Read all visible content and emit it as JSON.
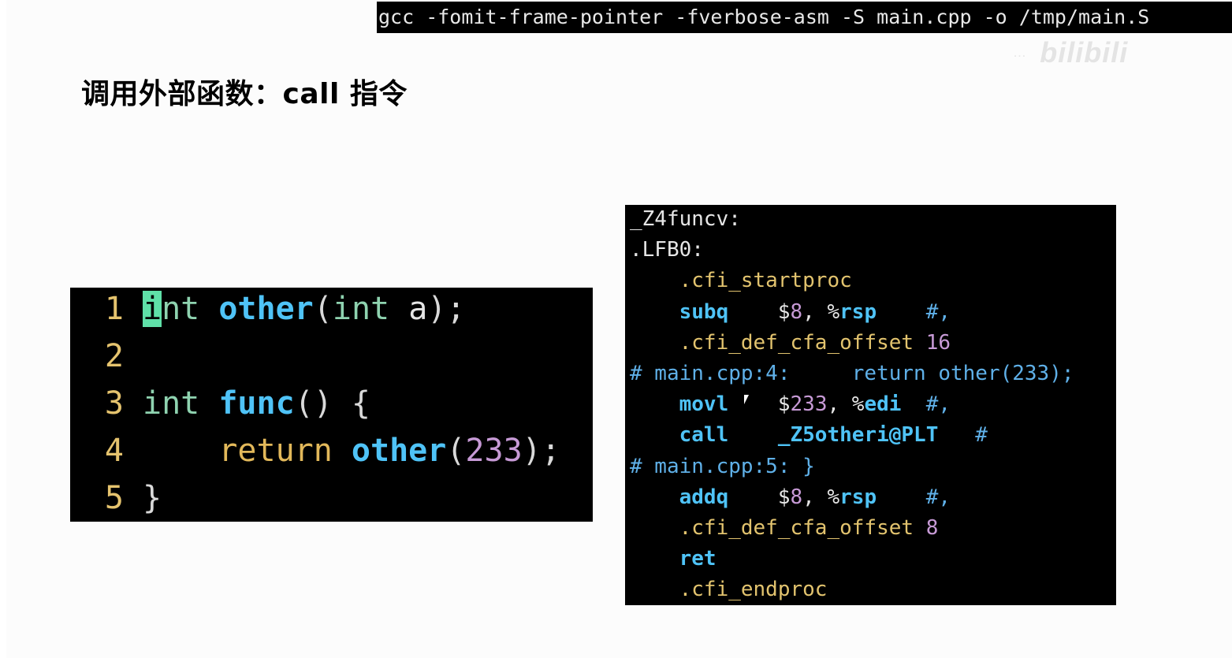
{
  "command": "gcc -fomit-frame-pointer -fverbose-asm -S main.cpp -o /tmp/main.S",
  "watermark": {
    "small": "…",
    "logo": "bilibili"
  },
  "title": "调用外部函数：call 指令",
  "source_code": [
    {
      "n": "1",
      "tokens": [
        {
          "t": "i",
          "c": "cursor"
        },
        {
          "t": "nt ",
          "c": "type"
        },
        {
          "t": "other",
          "c": "fn"
        },
        {
          "t": "(",
          "c": "punc"
        },
        {
          "t": "int",
          "c": "type"
        },
        {
          "t": " a",
          "c": "plain"
        },
        {
          "t": ");",
          "c": "punc"
        }
      ]
    },
    {
      "n": "2",
      "tokens": []
    },
    {
      "n": "3",
      "tokens": [
        {
          "t": "int ",
          "c": "type"
        },
        {
          "t": "func",
          "c": "fn"
        },
        {
          "t": "() {",
          "c": "punc"
        }
      ]
    },
    {
      "n": "4",
      "tokens": [
        {
          "t": "    return ",
          "c": "kw"
        },
        {
          "t": "other",
          "c": "fn"
        },
        {
          "t": "(",
          "c": "punc"
        },
        {
          "t": "233",
          "c": "num"
        },
        {
          "t": ");",
          "c": "punc"
        }
      ]
    },
    {
      "n": "5",
      "tokens": [
        {
          "t": "}",
          "c": "punc"
        }
      ]
    }
  ],
  "assembly": [
    {
      "tokens": [
        {
          "t": "_Z4funcv:",
          "c": "label"
        }
      ]
    },
    {
      "tokens": [
        {
          "t": ".LFB0:",
          "c": "label"
        }
      ]
    },
    {
      "tokens": [
        {
          "t": "    .cfi_startproc",
          "c": "dir"
        }
      ]
    },
    {
      "tokens": [
        {
          "t": "    subq",
          "c": "op"
        },
        {
          "t": "    $",
          "c": "dollar"
        },
        {
          "t": "8",
          "c": "num"
        },
        {
          "t": ", %",
          "c": "reg"
        },
        {
          "t": "rsp",
          "c": "regb"
        },
        {
          "t": "    #,",
          "c": "comment"
        }
      ]
    },
    {
      "tokens": [
        {
          "t": "    .cfi_def_cfa_offset ",
          "c": "dir"
        },
        {
          "t": "16",
          "c": "num"
        }
      ]
    },
    {
      "tokens": [
        {
          "t": "# main.cpp:4:     return other(233);",
          "c": "comment"
        }
      ]
    },
    {
      "tokens": [
        {
          "t": "    movl",
          "c": "op"
        },
        {
          "t": "    $",
          "c": "dollar"
        },
        {
          "t": "233",
          "c": "num"
        },
        {
          "t": ", %",
          "c": "reg"
        },
        {
          "t": "edi",
          "c": "regb"
        },
        {
          "t": "  #,",
          "c": "comment"
        }
      ]
    },
    {
      "tokens": [
        {
          "t": "    call",
          "c": "op"
        },
        {
          "t": "    _Z5otheri@PLT",
          "c": "regb"
        },
        {
          "t": "   #",
          "c": "comment"
        }
      ]
    },
    {
      "tokens": [
        {
          "t": "# main.cpp:5: }",
          "c": "comment"
        }
      ]
    },
    {
      "tokens": [
        {
          "t": "    addq",
          "c": "op"
        },
        {
          "t": "    $",
          "c": "dollar"
        },
        {
          "t": "8",
          "c": "num"
        },
        {
          "t": ", %",
          "c": "reg"
        },
        {
          "t": "rsp",
          "c": "regb"
        },
        {
          "t": "    #,",
          "c": "comment"
        }
      ]
    },
    {
      "tokens": [
        {
          "t": "    .cfi_def_cfa_offset ",
          "c": "dir"
        },
        {
          "t": "8",
          "c": "num"
        }
      ]
    },
    {
      "tokens": [
        {
          "t": "    ret",
          "c": "op"
        }
      ]
    },
    {
      "tokens": [
        {
          "t": "    .cfi_endproc",
          "c": "dir"
        }
      ]
    }
  ]
}
